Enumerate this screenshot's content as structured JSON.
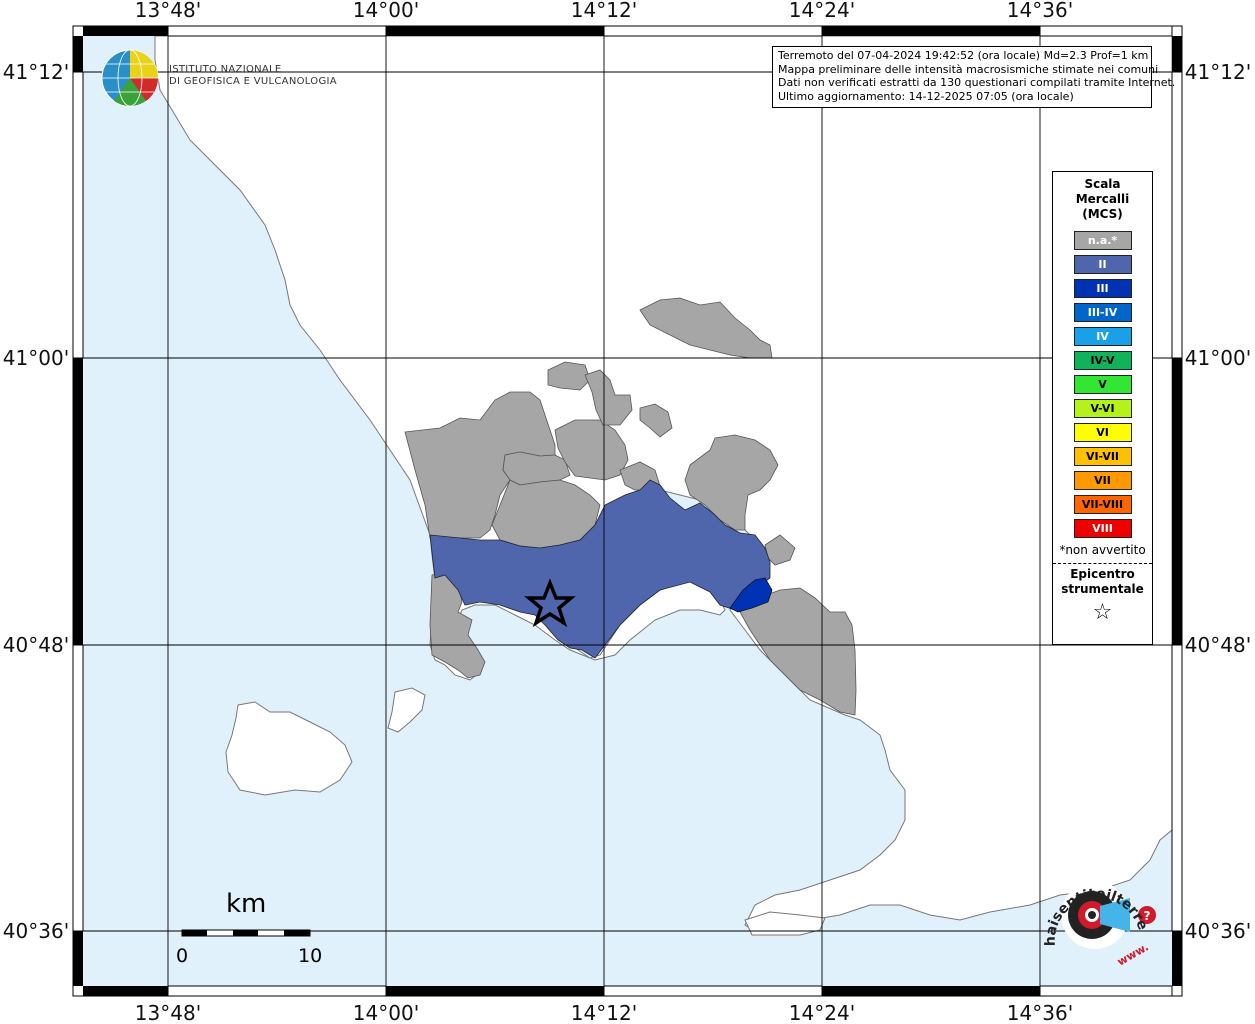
{
  "map": {
    "lon_labels": [
      "13°48'",
      "14°00'",
      "14°12'",
      "14°24'",
      "14°36'"
    ],
    "lat_labels": [
      "41°12'",
      "41°00'",
      "40°48'",
      "40°36'"
    ]
  },
  "info": {
    "line1": "Terremoto del 07-04-2024 19:42:52 (ora locale) Md=2.3 Prof=1 km",
    "line2": "Mappa preliminare delle intensità macrosismiche stimate nei comuni",
    "line3": "Dati non verificati estratti da 130 questionari compilati tramite Internet.",
    "line4": "Ultimo aggiornamento: 14-12-2025 07:05 (ora locale)"
  },
  "logo": {
    "line1": "ISTITUTO NAZIONALE",
    "line2": "DI GEOFISICA E VULCANOLOGIA"
  },
  "legend": {
    "title1": "Scala",
    "title2": "Mercalli",
    "title3": "(MCS)",
    "items": [
      {
        "label": "n.a.*",
        "color": "#a6a6a6",
        "text": "#ffffff"
      },
      {
        "label": "II",
        "color": "#5066ac",
        "text": "#ffffff"
      },
      {
        "label": "III",
        "color": "#0033b3",
        "text": "#ffffff"
      },
      {
        "label": "III-IV",
        "color": "#0066cc",
        "text": "#ffffff"
      },
      {
        "label": "IV",
        "color": "#1aa0e6",
        "text": "#ffffff"
      },
      {
        "label": "IV-V",
        "color": "#10b359",
        "text": "#000000"
      },
      {
        "label": "V",
        "color": "#33e633",
        "text": "#000000"
      },
      {
        "label": "V-VI",
        "color": "#b3f21a",
        "text": "#000000"
      },
      {
        "label": "VI",
        "color": "#ffff00",
        "text": "#000000"
      },
      {
        "label": "VI-VII",
        "color": "#ffc000",
        "text": "#000000"
      },
      {
        "label": "VII",
        "color": "#ff9900",
        "text": "#000000"
      },
      {
        "label": "VII-VIII",
        "color": "#ff6600",
        "text": "#000000"
      },
      {
        "label": "VIII",
        "color": "#ee0000",
        "text": "#ffffff"
      }
    ],
    "note": "*non avvertito",
    "epi1": "Epicentro",
    "epi2": "strumentale",
    "star": "☆"
  },
  "scale": {
    "unit": "km",
    "start": "0",
    "end": "10"
  },
  "colors": {
    "sea": "#e1f1fc",
    "land": "#ffffff",
    "na": "#a6a6a6",
    "II": "#5066ac",
    "III": "#0033b3"
  },
  "haisentito": {
    "text": "haisentitoilterremoto.it",
    "www": "www."
  }
}
